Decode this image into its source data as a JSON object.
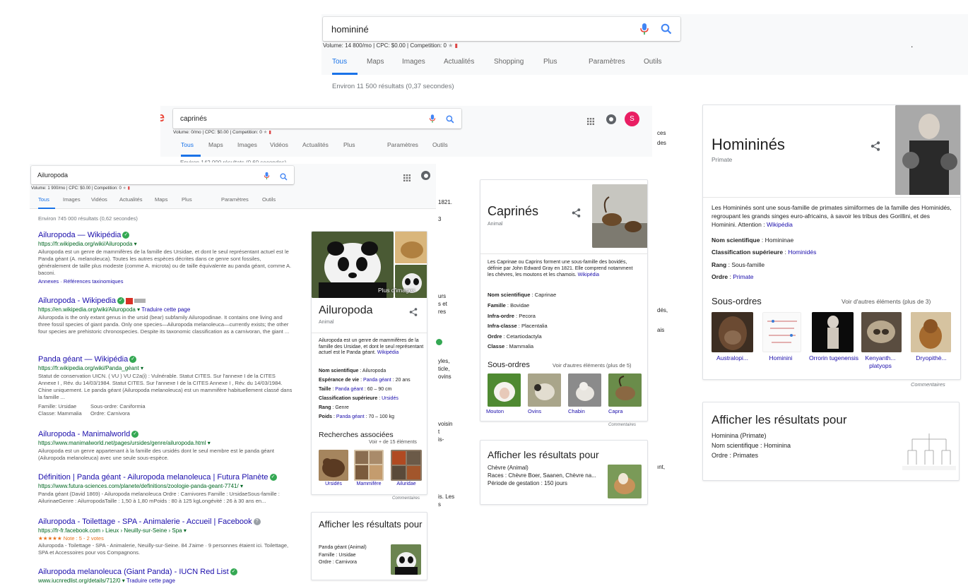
{
  "win1": {
    "query": "homininé",
    "seo": "Volume: 14 800/mo | CPC: $0.00 | Competition: 0",
    "tabs": [
      "Tous",
      "Maps",
      "Images",
      "Actualités",
      "Shopping",
      "Plus",
      "Paramètres",
      "Outils"
    ],
    "result_count": "Environ 11 500 résultats (0,37 secondes)",
    "dot": "."
  },
  "win2": {
    "query": "caprinés",
    "seo": "Volume: 0/mo | CPC: $0.00 | Competition: 0",
    "tabs": [
      "Tous",
      "Maps",
      "Images",
      "Vidéos",
      "Actualités",
      "Plus",
      "Paramètres",
      "Outils"
    ],
    "avatar_letter": "S",
    "peek_result_count": "Environ 142 000 résultats (0,60 secondes)",
    "edge_texts": [
      "ces",
      "des",
      "1821.",
      "3",
      "urs",
      "s et",
      "res",
      "yles,",
      "ticle,",
      "ovins",
      "voisin",
      "t",
      "is-",
      "is. Les",
      "s"
    ]
  },
  "win3": {
    "query": "Ailuropoda",
    "seo": "Volume: 1 900/mo | CPC: $0.00 | Competition: 0",
    "tabs": [
      "Tous",
      "Images",
      "Vidéos",
      "Actualités",
      "Maps",
      "Plus",
      "Paramètres",
      "Outils"
    ],
    "result_count": "Environ 745 000 résultats (0,62 secondes)",
    "results": [
      {
        "title": "Ailuropoda — Wikipédia",
        "url": "https://fr.wikipedia.org/wiki/Ailuropoda",
        "snippet": "Ailuropoda est un genre de mammifères de la famille des Ursidae, et dont le seul représentant actuel est le Panda géant (A. melanoleuca). Toutes les autres espèces décrites dans ce genre sont fossiles, généralement de taille plus modeste (comme A. microta) ou de taille équivalente au panda géant, comme A. baconi.",
        "links": "Annexes · Références taxinomiques"
      },
      {
        "title": "Ailuropoda - Wikipedia",
        "url": "https://en.wikipedia.org/wiki/Ailuropoda",
        "translate": "Traduire cette page",
        "snippet": "Ailuropoda is the only extant genus in the ursid (bear) subfamily Ailuropodinae. It contains one living and three fossil species of giant panda. Only one species—Ailuropoda melanoleuca—currently exists; the other four species are prehistoric chronospecies. Despite its taxonomic classification as a carnivoran, the giant ..."
      },
      {
        "title": "Panda géant — Wikipédia",
        "url": "https://fr.wikipedia.org/wiki/Panda_géant",
        "snippet": "Statut de conservation UICN. ( VU ) VU C2a(i) : Vulnérable. Statut CITES. Sur l'annexe I de la CITES Annexe I , Rév. du 14/03/1984. Statut CITES. Sur l'annexe I de la CITES Annexe I , Rév. du 14/03/1984. Chine uniquement. Le panda géant (Ailuropoda melanoleuca) est un mammifère habituellement classé dans la famille ...",
        "facts1": "Famille: Ursidae",
        "facts2": "Sous-ordre: Caniformia",
        "facts3": "Classe: Mammalia",
        "facts4": "Ordre: Carnivora"
      },
      {
        "title": "Ailuropoda - Manimalworld",
        "url": "https://www.manimalworld.net/pages/ursides/genre/ailuropoda.html",
        "snippet": "Ailuropoda est un genre appartenant à la famille des ursidés dont le seul membre est le panda géant (Ailuropoda melanoleuca) avec une seule sous-espèce."
      },
      {
        "title": "Définition | Panda géant - Ailuropoda melanoleuca | Futura Planète",
        "url": "https://www.futura-sciences.com/planete/definitions/zoologie-panda-geant-7741/",
        "snippet": "Panda géant (David 1869) - Ailuropoda melanoleuca Ordre : Carnivores Famille : UrsidaeSous-famille : AilurinaeGenre : AilurropodaTaille : 1,50 à 1,80 mPoids : 80 à 125 kgLongévité : 26 à 30 ans en..."
      },
      {
        "title": "Ailuropoda - Toilettage - SPA - Animalerie - Accueil | Facebook",
        "url": "https://fr-fr.facebook.com › Lieux › Neuilly-sur-Seine › Spa",
        "rating": "★★★★★ Note : 5 - 2 votes",
        "snippet": "Ailuropoda - Toilettage - SPA - Animalerie, Neuilly-sur-Seine. 84 J'aime · 9 personnes étaient ici. Toilettage, SPA et Accessoires pour vos Compagnons."
      },
      {
        "title": "Ailuropoda melanoleuca (Giant Panda) - IUCN Red List",
        "url": "www.iucnredlist.org/details/712/0",
        "translate": "Traduire cette page"
      }
    ]
  },
  "panel_ailuropoda": {
    "more_images": "Plus d'images",
    "title": "Ailuropoda",
    "subtitle": "Animal",
    "description": "Ailuropoda est un genre de mammifères de la famille des Ursidae, et dont le seul représentant actuel est le Panda géant.",
    "source": "Wikipédia",
    "facts": [
      {
        "k": "Nom scientifique",
        "v": "Ailuropoda",
        "link": false
      },
      {
        "k": "Espérance de vie",
        "v": "Panda géant",
        "v2": ": 20 ans",
        "link": true
      },
      {
        "k": "Taille",
        "v": "Panda géant",
        "v2": ": 60 – 90 cm",
        "link": true
      },
      {
        "k": "Classification supérieure",
        "v": "Ursidés",
        "link": true
      },
      {
        "k": "Rang",
        "v": "Genre",
        "link": false
      },
      {
        "k": "Poids",
        "v": "Panda géant",
        "v2": ": 70 – 100 kg",
        "link": true
      }
    ],
    "related_title": "Recherches associées",
    "related_more": "Voir + de 15 éléments",
    "related": [
      "Ursidés",
      "Mammifère",
      "Ailuridae"
    ],
    "footer": "Commentaires",
    "see_for_title": "Afficher les résultats pour",
    "see_for_name": "Panda géant (Animal)",
    "see_for_l1": "Famille : Ursidae",
    "see_for_l2": "Ordre : Carnivora"
  },
  "panel_caprines": {
    "title": "Caprinés",
    "subtitle": "Animal",
    "description": "Les Caprinae ou Caprins forment une sous-famille des bovidés, définie par John Edward Gray en 1821. Elle comprend notamment les chèvres, les moutons et les chamois.",
    "source": "Wikipédia",
    "facts": [
      {
        "k": "Nom scientifique",
        "v": "Caprinae"
      },
      {
        "k": "Famille",
        "v": "Bovidae"
      },
      {
        "k": "Infra-ordre",
        "v": "Pecora"
      },
      {
        "k": "Infra-classe",
        "v": "Placentalia"
      },
      {
        "k": "Ordre",
        "v": "Cetartiodactyla"
      },
      {
        "k": "Classe",
        "v": "Mammalia"
      }
    ],
    "sub_title": "Sous-ordres",
    "sub_more": "Voir d'autres éléments (plus de 5)",
    "sub": [
      "Mouton",
      "Ovins",
      "Chabin",
      "Capra"
    ],
    "footer": "Commentaires",
    "see_for_title": "Afficher les résultats pour",
    "see_for_name": "Chèvre (Animal)",
    "see_for_l1": "Races : Chèvre Boer, Saanen, Chèvre na...",
    "see_for_l2": "Période de gestation : 150 jours"
  },
  "panel_hominines": {
    "title": "Homininés",
    "subtitle": "Primate",
    "description": "Les Homininés sont une sous-famille de primates simiiformes de la famille des Hominidés, regroupant les grands singes euro-africains, à savoir les tribus des Gorillini, et des Hominini. Attention :",
    "source": "Wikipédia",
    "facts": [
      {
        "k": "Nom scientifique",
        "v": "Homininae",
        "link": false
      },
      {
        "k": "Classification supérieure",
        "v": "Hominidés",
        "link": true
      },
      {
        "k": "Rang",
        "v": "Sous-famille",
        "link": false
      },
      {
        "k": "Ordre",
        "v": "Primate",
        "link": true
      }
    ],
    "sub_title": "Sous-ordres",
    "sub_more": "Voir d'autres éléments (plus de 3)",
    "sub": [
      "Australopi...",
      "Hominini",
      "Orrorin tugenensis",
      "Kenyanth... platyops",
      "Dryopithè..."
    ],
    "footer": "Commentaires",
    "see_for_title": "Afficher les résultats pour",
    "see_for_name": "Hominina (Primate)",
    "see_for_l1": "Nom scientifique : Hominina",
    "see_for_l2": "Ordre : Primates",
    "mid_edge": [
      "dés,",
      "ais",
      "ınt,"
    ]
  },
  "colors": {
    "accent": "#1a73e8",
    "link": "#1a0dab",
    "url": "#006621",
    "avatar": "#e91e63"
  }
}
